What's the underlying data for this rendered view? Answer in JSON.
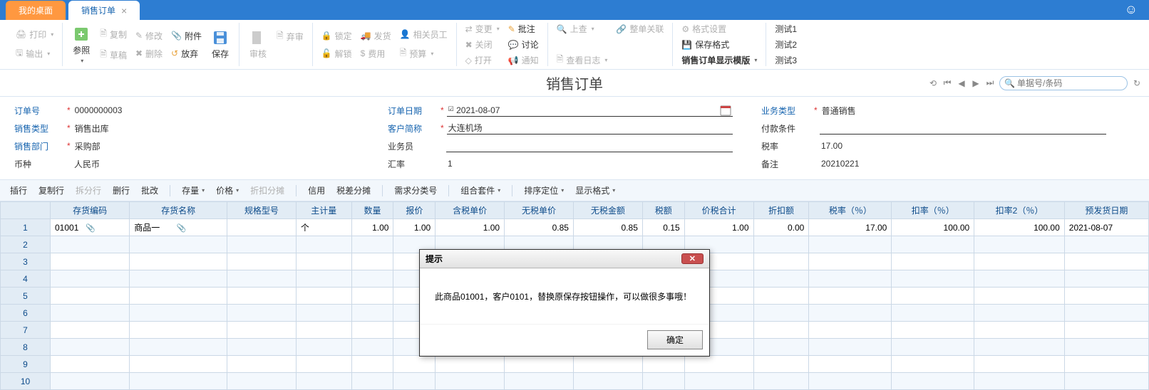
{
  "tabs": {
    "desktop": "我的桌面",
    "active": "销售订单"
  },
  "toolbar": {
    "l1": "打印",
    "l2": "输出",
    "l3": "参照",
    "l4": "复制",
    "l5": "草稿",
    "l6": "修改",
    "l7": "删除",
    "l8": "附件",
    "l9": "放弃",
    "l10": "保存",
    "l11": "审核",
    "l12": "弃审",
    "l13": "锁定",
    "l14": "解锁",
    "l15": "发货",
    "l16": "费用",
    "l17": "相关员工",
    "l18": "预算",
    "l19": "变更",
    "l20": "关闭",
    "l21": "打开",
    "l22": "批注",
    "l23": "讨论",
    "l24": "通知",
    "l25": "上查",
    "l26": "查看日志",
    "l27": "整单关联",
    "l28": "格式设置",
    "l29": "保存格式",
    "l30": "销售订单显示模版",
    "l31": "测试1",
    "l32": "测试2",
    "l33": "测试3"
  },
  "title": "销售订单",
  "search": {
    "placeholder": "单据号/条码"
  },
  "form": {
    "f1": {
      "label": "订单号",
      "value": "0000000003"
    },
    "f2": {
      "label": "销售类型",
      "value": "销售出库"
    },
    "f3": {
      "label": "销售部门",
      "value": "采购部"
    },
    "f4": {
      "label": "币种",
      "value": "人民币"
    },
    "f5": {
      "label": "订单日期",
      "value": "2021-08-07"
    },
    "f6": {
      "label": "客户简称",
      "value": "大连机场"
    },
    "f7": {
      "label": "业务员",
      "value": ""
    },
    "f8": {
      "label": "汇率",
      "value": "1"
    },
    "f9": {
      "label": "业务类型",
      "value": "普通销售"
    },
    "f10": {
      "label": "付款条件",
      "value": ""
    },
    "f11": {
      "label": "税率",
      "value": "17.00"
    },
    "f12": {
      "label": "备注",
      "value": "20210221"
    }
  },
  "grid_toolbar": {
    "t1": "插行",
    "t2": "复制行",
    "t3": "拆分行",
    "t4": "删行",
    "t5": "批改",
    "t6": "存量",
    "t7": "价格",
    "t8": "折扣分摊",
    "t9": "信用",
    "t10": "税差分摊",
    "t11": "需求分类号",
    "t12": "组合套件",
    "t13": "排序定位",
    "t14": "显示格式"
  },
  "cols": [
    "存货编码",
    "存货名称",
    "规格型号",
    "主计量",
    "数量",
    "报价",
    "含税单价",
    "无税单价",
    "无税金额",
    "税额",
    "价税合计",
    "折扣额",
    "税率（％）",
    "扣率（％）",
    "扣率2（％）",
    "预发货日期"
  ],
  "row1": {
    "code": "01001",
    "name": "商品一",
    "uom": "个",
    "qty": "1.00",
    "quote": "1.00",
    "taxp": "1.00",
    "notaxp": "0.85",
    "notaxa": "0.85",
    "taxa": "0.15",
    "total": "1.00",
    "disc": "0.00",
    "trate": "17.00",
    "drate": "100.00",
    "drate2": "100.00",
    "date": "2021-08-07"
  },
  "dialog": {
    "title": "提示",
    "msg": "此商品01001，客户0101，替换原保存按钮操作，可以做很多事哦！",
    "ok": "确定"
  }
}
